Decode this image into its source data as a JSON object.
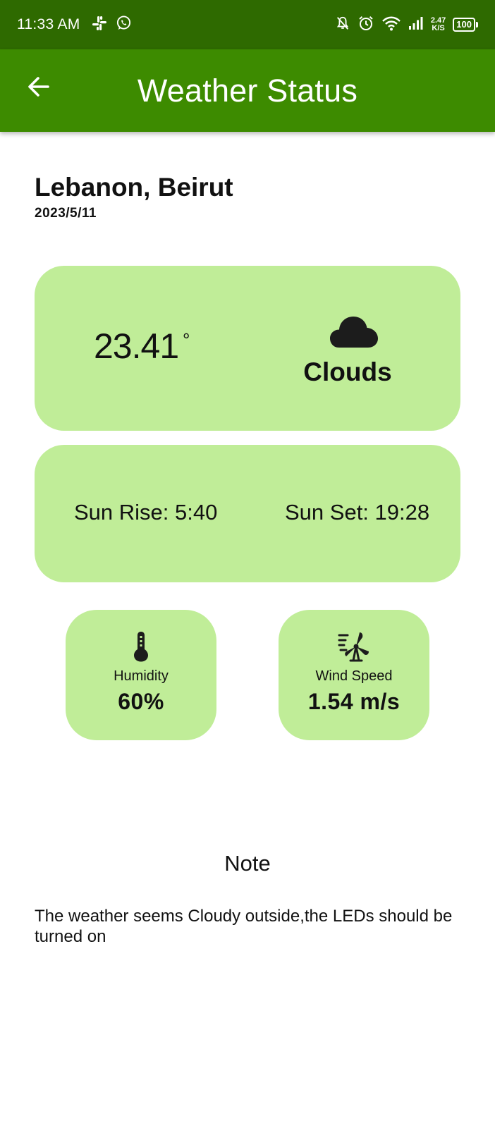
{
  "status_bar": {
    "time": "11:33 AM",
    "left_icons": [
      "slack-icon",
      "whatsapp-icon"
    ],
    "right_icons": [
      "bell-off-icon",
      "alarm-icon",
      "wifi-icon",
      "signal-icon"
    ],
    "net_speed_value": "2.47",
    "net_speed_unit": "K/S",
    "battery": "100"
  },
  "app_bar": {
    "title": "Weather Status",
    "back_icon": "arrow-left-icon"
  },
  "location": {
    "name": "Lebanon, Beirut",
    "date": "2023/5/11"
  },
  "weather": {
    "temperature": "23.41",
    "degree_symbol": "°",
    "condition": "Clouds",
    "condition_icon": "cloud-icon"
  },
  "sun": {
    "sunrise": "Sun Rise: 5:40",
    "sunset": "Sun Set: 19:28"
  },
  "humidity": {
    "label": "Humidity",
    "value": "60%",
    "icon": "thermometer-icon"
  },
  "wind": {
    "label": "Wind Speed",
    "value": "1.54 m/s",
    "icon": "wind-turbine-icon"
  },
  "note": {
    "title": "Note",
    "text": "The weather seems Cloudy outside,the LEDs should be turned on"
  },
  "colors": {
    "status_bar": "#2e6a00",
    "app_bar": "#3d8b00",
    "card": "#c0ed98"
  }
}
